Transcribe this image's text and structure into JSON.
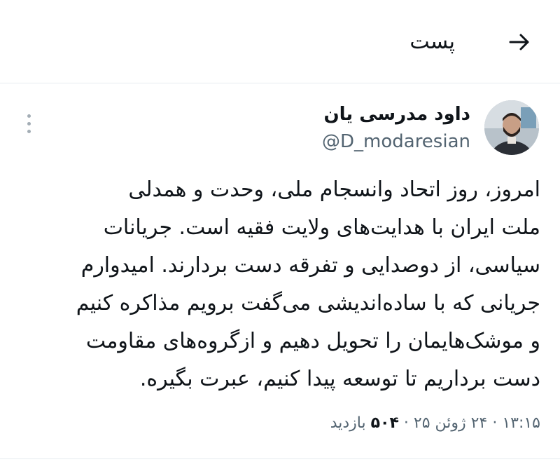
{
  "header": {
    "title": "پست",
    "back_icon": "arrow-right-icon"
  },
  "tweet": {
    "author_name": "داود مدرسی یان",
    "author_handle": "@D_modaresian",
    "avatar_icon": "avatar-photo",
    "more_icon": "more-vertical-icon",
    "text_lines": [
      "امروز، روز اتحاد وانسجام ملی، وحدت و همدلی",
      "ملت ایران با هدایت‌های ولایت فقیه است. جریانات",
      "سیاسی، از دوصدایی و تفرقه دست بردارند. امیدوارم",
      "جریانی که با ساده‌اندیشی می‌گفت برویم مذاکره کنیم",
      "و موشک‌هایمان را تحویل دهیم و ازگروه‌های مقاومت",
      "دست برداریم تا توسعه پیدا کنیم، عبرت بگیره."
    ],
    "time": "۱۳:۱۵",
    "date": "۲۴ ژوئن ۲۵",
    "views_count": "۵۰۴",
    "views_label": "بازدید",
    "separator": "·"
  },
  "colors": {
    "text": "#0f1419",
    "secondary": "#536471",
    "divider": "#e6ecf0"
  }
}
